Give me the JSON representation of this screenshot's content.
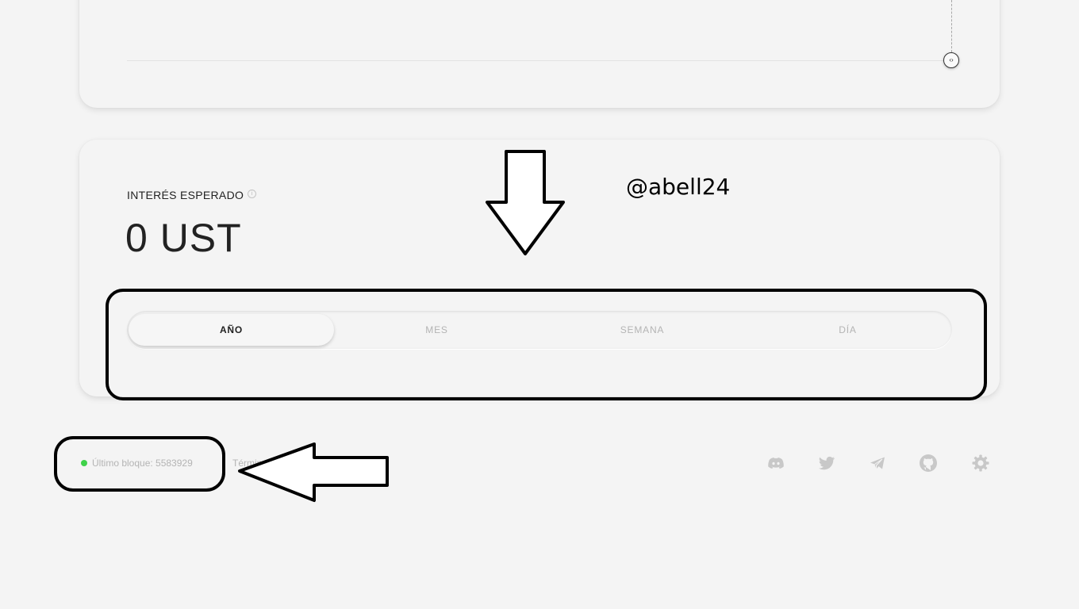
{
  "interest": {
    "label": "INTERÉS ESPERADO",
    "info_icon": "info-icon",
    "value": "0 UST"
  },
  "period_tabs": [
    {
      "label": "AÑO",
      "active": true
    },
    {
      "label": "MES",
      "active": false
    },
    {
      "label": "SEMANA",
      "active": false
    },
    {
      "label": "DÍA",
      "active": false
    }
  ],
  "footer": {
    "last_block": "Último bloque: 5583929",
    "terms": "Términos",
    "status_color": "#3fd24a",
    "social_icons": [
      "discord-icon",
      "twitter-icon",
      "telegram-icon",
      "github-icon",
      "settings-icon"
    ]
  },
  "annotation": {
    "watermark": "@abell24"
  }
}
